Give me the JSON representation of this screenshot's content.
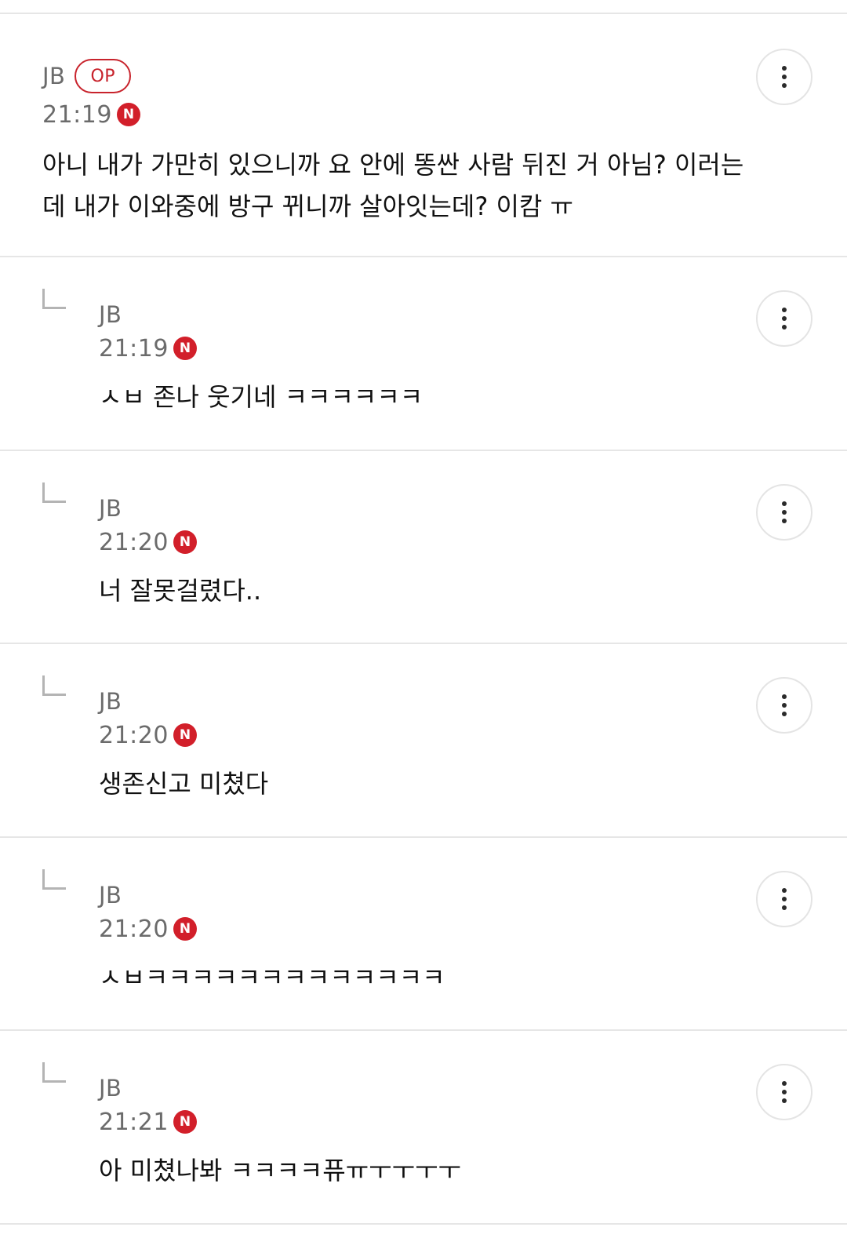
{
  "comments": [
    {
      "author": "JB",
      "op_badge": "OP",
      "time": "21:19",
      "new_badge": "N",
      "text": "아니 내가 가만히 있으니까 요 안에 똥싼 사람 뒤진 거 아님? 이러는\n데 내가 이와중에 방구 뀌니까 살아잇는데? 이캄 ㅠ"
    },
    {
      "author": "JB",
      "time": "21:19",
      "new_badge": "N",
      "text": "ㅅㅂ 존나 웃기네 ㅋㅋㅋㅋㅋㅋ"
    },
    {
      "author": "JB",
      "time": "21:20",
      "new_badge": "N",
      "text": "너 잘못걸렸다.."
    },
    {
      "author": "JB",
      "time": "21:20",
      "new_badge": "N",
      "text": "생존신고 미쳤다"
    },
    {
      "author": "JB",
      "time": "21:20",
      "new_badge": "N",
      "text": "ㅅㅂㅋㅋㅋㅋㅋㅋㅋㅋㅋㅋㅋㅋㅋ"
    },
    {
      "author": "JB",
      "time": "21:21",
      "new_badge": "N",
      "text": "아 미쳤나봐 ㅋㅋㅋㅋ퓨ㅠㅜㅜㅜㅜ"
    }
  ],
  "colors": {
    "accent_red": "#d21f2a",
    "op_border": "#c8232c",
    "meta_text": "#6b6b6b",
    "divider": "#e6e6e6"
  },
  "icons": {
    "more": "more-vertical-icon",
    "reply": "reply-arrow-icon"
  }
}
